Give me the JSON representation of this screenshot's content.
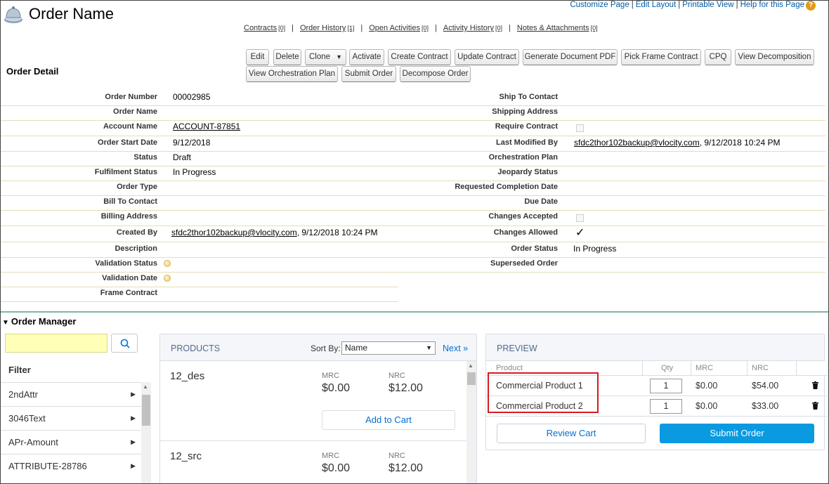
{
  "header": {
    "title": "Order Name",
    "top_links": [
      "Customize Page",
      "Edit Layout",
      "Printable View",
      "Help for this Page"
    ],
    "help_icon": "?"
  },
  "related_links": [
    {
      "label": "Contracts",
      "count": "[0]"
    },
    {
      "label": "Order History",
      "count": "[1]"
    },
    {
      "label": "Open Activities",
      "count": "[0]"
    },
    {
      "label": "Activity History",
      "count": "[0]"
    },
    {
      "label": "Notes & Attachments",
      "count": "[0]"
    }
  ],
  "section_title": "Order Detail",
  "buttons": [
    "Edit",
    "Delete",
    "Clone",
    "Activate",
    "Create Contract",
    "Update Contract",
    "Generate Document PDF",
    "Pick Frame Contract",
    "CPQ",
    "View Decomposition",
    "View Orchestration Plan",
    "Submit Order",
    "Decompose Order"
  ],
  "detail_left": [
    {
      "label": "Order Number",
      "value": "00002985"
    },
    {
      "label": "Order Name",
      "value": ""
    },
    {
      "label": "Account Name",
      "value": "ACCOUNT-87851"
    },
    {
      "label": "Order Start Date",
      "value": "9/12/2018"
    },
    {
      "label": "Status",
      "value": "Draft"
    },
    {
      "label": "Fulfilment Status",
      "value": "In Progress"
    },
    {
      "label": "Order Type",
      "value": ""
    },
    {
      "label": "Bill To Contact",
      "value": ""
    },
    {
      "label": "Billing Address",
      "value": ""
    },
    {
      "label": "Created By",
      "value": "sfdc2thor102backup@vlocity.com",
      "suffix": ", 9/12/2018 10:24 PM"
    },
    {
      "label": "Description",
      "value": ""
    },
    {
      "label": "Validation Status",
      "value": ""
    },
    {
      "label": "Validation Date",
      "value": ""
    },
    {
      "label": "Frame Contract",
      "value": ""
    }
  ],
  "detail_right": [
    {
      "label": "Ship To Contact",
      "value": ""
    },
    {
      "label": "Shipping Address",
      "value": ""
    },
    {
      "label": "Require Contract",
      "value": ""
    },
    {
      "label": "Last Modified By",
      "value": "sfdc2thor102backup@vlocity.com",
      "suffix": ", 9/12/2018 10:24 PM"
    },
    {
      "label": "Orchestration Plan",
      "value": ""
    },
    {
      "label": "Jeopardy Status",
      "value": ""
    },
    {
      "label": "Requested Completion Date",
      "value": ""
    },
    {
      "label": "Due Date",
      "value": ""
    },
    {
      "label": "Changes Accepted",
      "value": ""
    },
    {
      "label": "Changes Allowed",
      "value": "✓"
    },
    {
      "label": "Order Status",
      "value": "In Progress"
    },
    {
      "label": "Superseded Order",
      "value": ""
    }
  ],
  "order_manager": {
    "title": "Order Manager",
    "search_value": "",
    "filter_title": "Filter",
    "filters": [
      "2ndAttr",
      "3046Text",
      "APr-Amount",
      "ATTRIBUTE-28786"
    ]
  },
  "products": {
    "title": "PRODUCTS",
    "sort_label": "Sort By:",
    "sort_value": "Name",
    "next": "Next »",
    "mrc_label": "MRC",
    "nrc_label": "NRC",
    "add_label": "Add to Cart",
    "items": [
      {
        "name": "12_des",
        "mrc": "$0.00",
        "nrc": "$12.00"
      },
      {
        "name": "12_src",
        "mrc": "$0.00",
        "nrc": "$12.00"
      }
    ]
  },
  "preview": {
    "title": "PREVIEW",
    "columns": [
      "Product",
      "Qty",
      "MRC",
      "NRC"
    ],
    "rows": [
      {
        "product": "Commercial Product 1",
        "qty": "1",
        "mrc": "$0.00",
        "nrc": "$54.00"
      },
      {
        "product": "Commercial Product 2",
        "qty": "1",
        "mrc": "$0.00",
        "nrc": "$33.00"
      }
    ],
    "review_label": "Review Cart",
    "submit_label": "Submit Order"
  },
  "colors": {
    "accent": "#0070d2",
    "submit": "#0a9ae0",
    "highlight": "#d51b22",
    "search_bg": "#ffffb8"
  }
}
